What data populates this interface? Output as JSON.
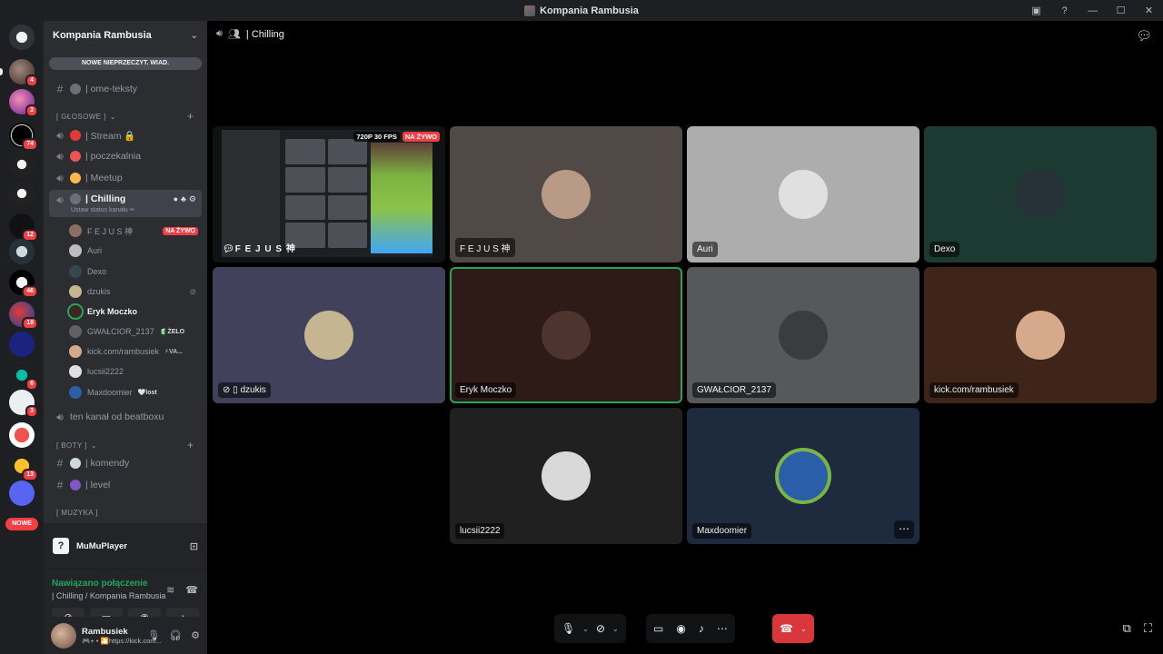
{
  "window": {
    "title": "Kompania Rambusia"
  },
  "rail": {
    "badges": [
      "4",
      "3",
      "74",
      "12",
      "46",
      "19",
      "6",
      "3",
      "13"
    ],
    "new_label": "NOWE"
  },
  "sidebar": {
    "server_name": "Kompania Rambusia",
    "unread_pill": "NOWE NIEPRZECZYT. WIAD.",
    "text_channels_top": [
      {
        "label": "| ome-teksty"
      }
    ],
    "voice_category": "[ GŁOSOWE ]",
    "voice_channels": [
      {
        "label": "| Stream 🔒"
      },
      {
        "label": "| poczekalnia"
      },
      {
        "label": "| Meetup"
      }
    ],
    "active_channel": {
      "label": "| Chilling",
      "status_hint": "Ustaw status kanału ✏"
    },
    "voice_users": [
      {
        "name": "F E J U S 神",
        "live": "NA ŻYWO"
      },
      {
        "name": "Auri"
      },
      {
        "name": "Dexo"
      },
      {
        "name": "dzukis"
      },
      {
        "name": "Eryk Moczko"
      },
      {
        "name": "GWAŁCIOR_2137",
        "tag": "🧃ŻELO"
      },
      {
        "name": "kick.com/rambusiek",
        "tag": "⚡VA..."
      },
      {
        "name": "lucsii2222"
      },
      {
        "name": "Maxdoomier",
        "tag": "🤍lost"
      }
    ],
    "extra_voice": "ten kanał od beatboxu",
    "bots_category": "[ BOTY ]",
    "bot_channels": [
      {
        "label": "| komendy"
      },
      {
        "label": "| level"
      }
    ],
    "music_category": "[ MUZYKA ]"
  },
  "app_panel": {
    "name": "MuMuPlayer"
  },
  "voice_panel": {
    "status": "Nawiązano połączenie",
    "location": "| Chilling / Kompania Rambusia"
  },
  "user_panel": {
    "name": "Rambusiek",
    "status": "🎮+ • 🎦https://kick.com..."
  },
  "call": {
    "channel": "| Chilling",
    "stream_quality": "720P 30 FPS",
    "stream_live": "NA ŻYWO",
    "stream_name": "F E J U S 神",
    "tiles": [
      {
        "name": "F E J U S 神",
        "bg": "#504945",
        "avatar": "#b89a86"
      },
      {
        "name": "Auri",
        "bg": "#adadad",
        "avatar": "#e0e0e0"
      },
      {
        "name": "Dexo",
        "bg": "#1d3a32",
        "avatar": "#263238"
      },
      {
        "name": "dzukis",
        "bg": "#41415c",
        "avatar": "#c5b590"
      },
      {
        "name": "Eryk Moczko",
        "bg": "#2e1a17",
        "avatar": "#4e342e",
        "speaking": true
      },
      {
        "name": "GWAŁCIOR_2137",
        "bg": "#55595c",
        "avatar": "#3a3c40"
      },
      {
        "name": "kick.com/rambusiek",
        "bg": "#3e2419",
        "avatar": "#d7a98c"
      },
      {
        "name": "lucsii2222",
        "bg": "#202020",
        "avatar": "#d9d9d9"
      },
      {
        "name": "Maxdoomier",
        "bg": "#1e2a3e",
        "avatar": "#2b5ea8"
      }
    ]
  },
  "colors": {
    "accent_green": "#23a55a",
    "danger": "#da373c",
    "brand": "#5865f2"
  }
}
